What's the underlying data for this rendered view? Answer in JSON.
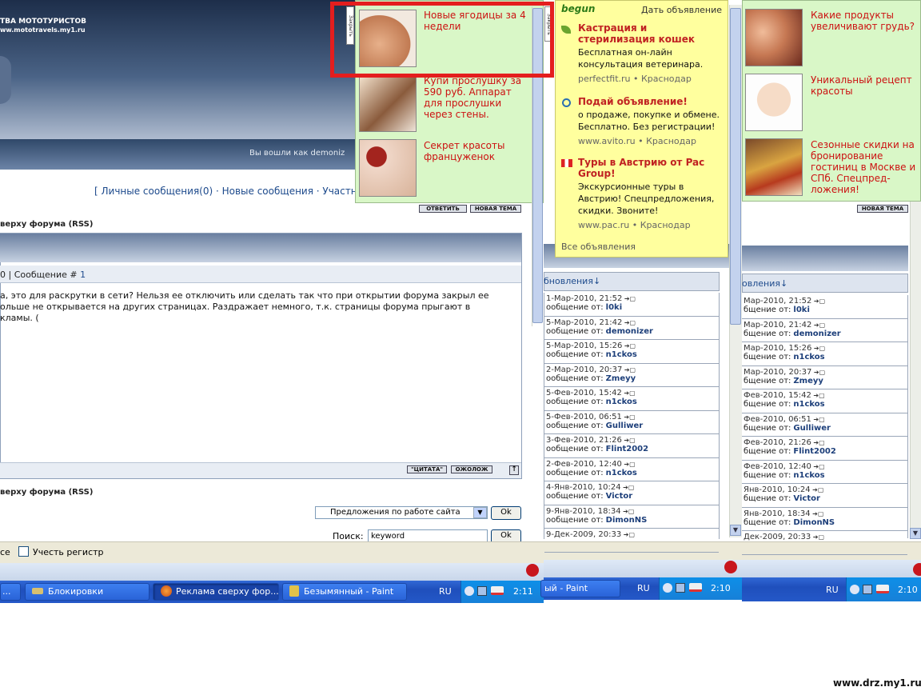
{
  "header": {
    "title": "ТВА МОТОТУРИСТОВ",
    "url": "ww.mototravels.my1.ru",
    "logged_in": "Вы вошли как demoniz"
  },
  "nav": {
    "text": "[ Личные сообщения(0) · Новые сообщения · Участник"
  },
  "buttons": {
    "reply": "ОТВЕТИТЬ",
    "new_topic": "НОВАЯ ТЕМА",
    "new_topic_right": "НОВАЯ ТЕМА",
    "quote": "\"ЦИТАТА\"",
    "complain": "ОЖОЛОЖ",
    "ok1": "Ok",
    "ok2": "Ok"
  },
  "topic": {
    "line_top": "верху форума (RSS)",
    "line_bottom": "верху форума (RSS)",
    "post_header_number": "0 | Сообщение # ",
    "post_header_link": "1",
    "post_text": [
      "а, это для раскрутки в сети? Нельзя ее отключить или сделать так что при открытии форума закрыл ее",
      "ольше не открывается на других страницах. Раздражает немного, т.к. страницы форума прыгают в",
      "кламы. ("
    ]
  },
  "forum_select": "Предложения по работе сайта",
  "search": {
    "label": "Поиск:",
    "value": "keyword"
  },
  "register": {
    "left_text": "се",
    "label": "Учесть регистр"
  },
  "ad_left": {
    "close": "Закрыть",
    "items": [
      {
        "text": "Новые ягодицы за 4 недели"
      },
      {
        "text": "Купи прослушку за 590 руб. Аппарат для прослушки через стены."
      },
      {
        "text": "Секрет красоты француженок"
      }
    ]
  },
  "begun": {
    "brand": "begun",
    "place_ad": "Дать объявление",
    "all": "Все объявления",
    "items": [
      {
        "title": "Кастрация и стерилизация кошек",
        "desc": "Бесплатная он-лайн консультация ветеринара.",
        "url": "perfectfit.ru",
        "city": "Краснодар"
      },
      {
        "title": "Подай объявление!",
        "desc": "о продаже, покупке и обмене. Бесплатно. Без регистрации!",
        "url": "www.avito.ru",
        "city": "Краснодар"
      },
      {
        "title": "Туры в Австрию от Pac Group!",
        "desc": "Экскурсионные туры в Австрию! Спецпредложения, скидки. Звоните!",
        "url": "www.pac.ru",
        "city": "Краснодар"
      }
    ]
  },
  "ad_right": {
    "items": [
      {
        "text": "Какие продукты увеличивают грудь?"
      },
      {
        "text": "Уникальный рецепт красоты"
      },
      {
        "text": "Сезонные скидки на бронирование гостиниц в Москве и СПб. Спецпред-ложения!"
      }
    ]
  },
  "updates_mid": {
    "header": "бновления↓",
    "rows": [
      {
        "date": "1-Мар-2010, 21:52",
        "from": "ообщение от:",
        "author": "l0ki"
      },
      {
        "date": "5-Мар-2010, 21:42",
        "from": "ообщение от:",
        "author": "demonizer"
      },
      {
        "date": "5-Мар-2010, 15:26",
        "from": "ообщение от:",
        "author": "n1ckos"
      },
      {
        "date": "2-Мар-2010, 20:37",
        "from": "ообщение от:",
        "author": "Zmeyy"
      },
      {
        "date": "5-Фев-2010, 15:42",
        "from": "ообщение от:",
        "author": "n1ckos"
      },
      {
        "date": "5-Фев-2010, 06:51",
        "from": "ообщение от:",
        "author": "Gulliwer"
      },
      {
        "date": "3-Фев-2010, 21:26",
        "from": "ообщение от:",
        "author": "Flint2002"
      },
      {
        "date": "2-Фев-2010, 12:40",
        "from": "ообщение от:",
        "author": "n1ckos"
      },
      {
        "date": "4-Янв-2010, 10:24",
        "from": "ообщение от:",
        "author": "Victor"
      },
      {
        "date": "9-Янв-2010, 18:34",
        "from": "ообщение от:",
        "author": "DimonNS"
      },
      {
        "date": "9-Дек-2009, 20:33",
        "from": "",
        "author": ""
      }
    ]
  },
  "updates_right": {
    "header": "овления↓",
    "rows": [
      {
        "date": "Мар-2010, 21:52",
        "from": "бщение от:",
        "author": "l0ki"
      },
      {
        "date": "Мар-2010, 21:42",
        "from": "бщение от:",
        "author": "demonizer"
      },
      {
        "date": "Мар-2010, 15:26",
        "from": "бщение от:",
        "author": "n1ckos"
      },
      {
        "date": "Мар-2010, 20:37",
        "from": "бщение от:",
        "author": "Zmeyy"
      },
      {
        "date": "Фев-2010, 15:42",
        "from": "бщение от:",
        "author": "n1ckos"
      },
      {
        "date": "Фев-2010, 06:51",
        "from": "бщение от:",
        "author": "Gulliwer"
      },
      {
        "date": "Фев-2010, 21:26",
        "from": "бщение от:",
        "author": "Flint2002"
      },
      {
        "date": "Фев-2010, 12:40",
        "from": "бщение от:",
        "author": "n1ckos"
      },
      {
        "date": "Янв-2010, 10:24",
        "from": "бщение от:",
        "author": "Victor"
      },
      {
        "date": "Янв-2010, 18:34",
        "from": "бщение от:",
        "author": "DimonNS"
      },
      {
        "date": "Дек-2009, 20:33",
        "from": "",
        "author": ""
      }
    ]
  },
  "taskbar": {
    "item_dots": "...",
    "blocks": "Блокировки",
    "firefox": "Реклама сверху фор...",
    "paint": "Безымянный - Paint",
    "paint_mid": "ый - Paint",
    "lang": "RU",
    "clock1": "2:11",
    "clock2": "2:10",
    "clock3": "2:10"
  },
  "watermark": "www.drz.my1.ru",
  "colors": {
    "ad_green": "#d9f7c7",
    "begun_yellow": "#ffff9e",
    "ad_red_text": "#cc1111",
    "highlight_red": "#e41e1e",
    "taskbar_blue": "#245edb"
  }
}
